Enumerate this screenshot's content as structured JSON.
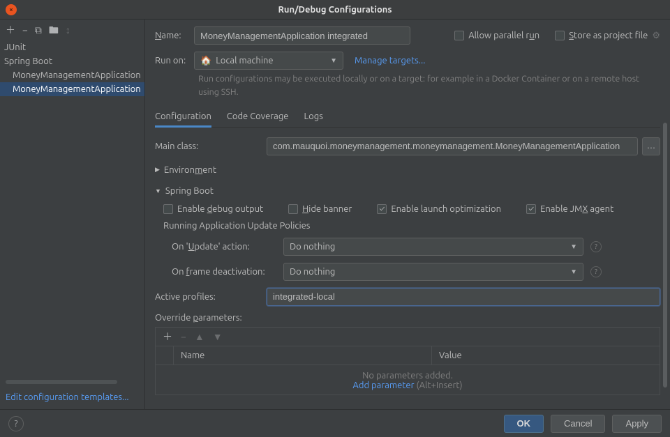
{
  "titlebar": {
    "title": "Run/Debug Configurations"
  },
  "sidebar": {
    "categories": [
      {
        "label": "JUnit"
      },
      {
        "label": "Spring Boot",
        "items": [
          {
            "label": "MoneyManagementApplication",
            "selected": false
          },
          {
            "label": "MoneyManagementApplication",
            "selected": true
          }
        ]
      }
    ],
    "edit_templates": "Edit configuration templates..."
  },
  "header": {
    "name_label": "Name:",
    "name_value": "MoneyManagementApplication integrated",
    "allow_parallel": "Allow parallel run",
    "store_project": "Store as project file",
    "run_on_label": "Run on:",
    "run_on_value": "Local machine",
    "manage_targets": "Manage targets...",
    "help_text": "Run configurations may be executed locally or on a target: for example in a Docker Container or on a remote host using SSH."
  },
  "tabs": {
    "items": [
      "Configuration",
      "Code Coverage",
      "Logs"
    ],
    "active": 0
  },
  "config": {
    "main_class_label": "Main class:",
    "main_class_value": "com.mauquoi.moneymanagement.moneymanagement.MoneyManagementApplication",
    "environment_label": "Environment",
    "spring_boot_label": "Spring Boot",
    "enable_debug": {
      "label": "Enable debug output",
      "checked": false
    },
    "hide_banner": {
      "label": "Hide banner",
      "checked": false
    },
    "enable_launch_opt": {
      "label": "Enable launch optimization",
      "checked": true
    },
    "enable_jmx": {
      "label": "Enable JMX agent",
      "checked": true
    },
    "running_policies_title": "Running Application Update Policies",
    "on_update_label": "On 'Update' action:",
    "on_update_value": "Do nothing",
    "on_frame_label": "On frame deactivation:",
    "on_frame_value": "Do nothing",
    "active_profiles_label": "Active profiles:",
    "active_profiles_value": "integrated-local",
    "override_params_label": "Override parameters:",
    "table": {
      "col_name": "Name",
      "col_value": "Value",
      "empty_text": "No parameters added.",
      "add_text": "Add parameter",
      "add_hint": " (Alt+Insert)"
    }
  },
  "footer": {
    "ok": "OK",
    "cancel": "Cancel",
    "apply": "Apply"
  }
}
